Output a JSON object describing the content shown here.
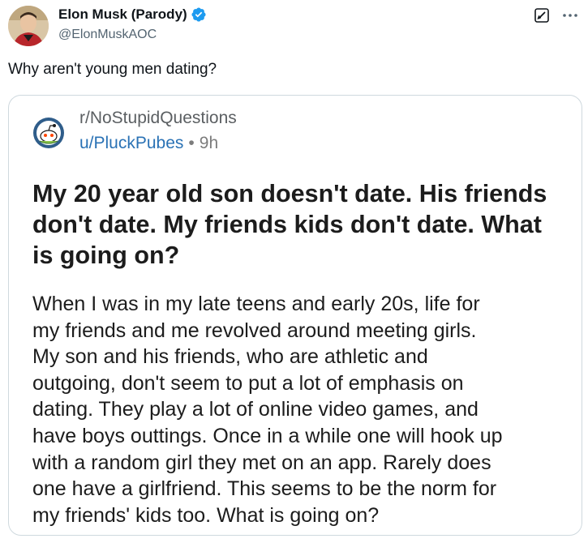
{
  "tweet": {
    "author": {
      "display_name": "Elon Musk (Parody)",
      "handle": "@ElonMuskAOC",
      "verified": true
    },
    "text": "Why aren't young men dating?",
    "icons": {
      "verified": "verified-badge-icon",
      "grok": "grok-icon",
      "more": "more-options-icon"
    }
  },
  "embedded_post": {
    "subreddit": "r/NoStupidQuestions",
    "author": "u/PluckPubes",
    "separator": "•",
    "age": "9h",
    "title": "My 20 year old son doesn't date. His friends don't date. My friends kids don't date. What is going on?",
    "body_lines": [
      "When I was in my late teens and early 20s, life for",
      "my friends and me revolved around meeting girls.",
      "My son and his friends, who are athletic and",
      "outgoing, don't seem to put a lot of emphasis on",
      "dating. They play a lot of online video games, and",
      "have boys outtings. Once in a while one will hook up",
      "with a random girl they met on an app.  Rarely does",
      "one have a girlfriend. This seems to be the norm for",
      "my friends' kids too.  What is going on?"
    ]
  },
  "colors": {
    "verified_blue": "#1d9bf0",
    "handle_gray": "#536471",
    "reddit_link_blue": "#2a72b5",
    "border": "#cfd9de"
  }
}
